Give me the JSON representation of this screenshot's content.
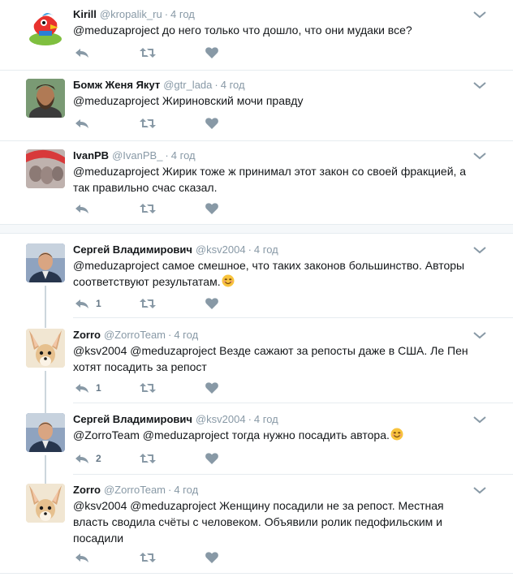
{
  "tweets": [
    {
      "name": "Kirill",
      "handle": "@kropalik_ru",
      "time": "4 год",
      "text": "@meduzaproject до него только что дошло, что они мудаки все?",
      "replies": "",
      "has_emoji": false
    },
    {
      "name": "Бомж Женя Якут",
      "handle": "@gtr_lada",
      "time": "4 год",
      "text": "@meduzaproject Жириновский мочи правду",
      "replies": "",
      "has_emoji": false
    },
    {
      "name": "IvanPB",
      "handle": "@IvanPB_",
      "time": "4 год",
      "text": "@meduzaproject Жирик тоже ж принимал этот закон со своей фракцией, а так правильно счас сказал.",
      "replies": "",
      "has_emoji": false
    },
    {
      "name": "Сергей Владимирович",
      "handle": "@ksv2004",
      "time": "4 год",
      "text": "@meduzaproject самое смешное, что таких законов большинство. Авторы соответствуют результатам.",
      "replies": "1",
      "has_emoji": true
    },
    {
      "name": "Zorro",
      "handle": "@ZorroTeam",
      "time": "4 год",
      "text": "@ksv2004 @meduzaproject Везде сажают за репосты даже в США. Ле Пен хотят посадить за репост",
      "replies": "1",
      "has_emoji": false
    },
    {
      "name": "Сергей Владимирович",
      "handle": "@ksv2004",
      "time": "4 год",
      "text": "@ZorroTeam @meduzaproject тогда нужно посадить автора.",
      "replies": "2",
      "has_emoji": true
    },
    {
      "name": "Zorro",
      "handle": "@ZorroTeam",
      "time": "4 год",
      "text": "@ksv2004 @meduzaproject Женщину посадили не за репост. Местная власть сводила счёты с человеком. Объявили ролик педофильским и посадили",
      "replies": "",
      "has_emoji": false
    }
  ],
  "ui": {
    "dot": "·",
    "icons": [
      "reply-icon",
      "retweet-icon",
      "like-icon",
      "chevron-down-icon"
    ]
  },
  "colors": {
    "icon_gray": "#8899a6",
    "separator": "#e6ecf0",
    "thread_line": "#ccd6dd"
  }
}
